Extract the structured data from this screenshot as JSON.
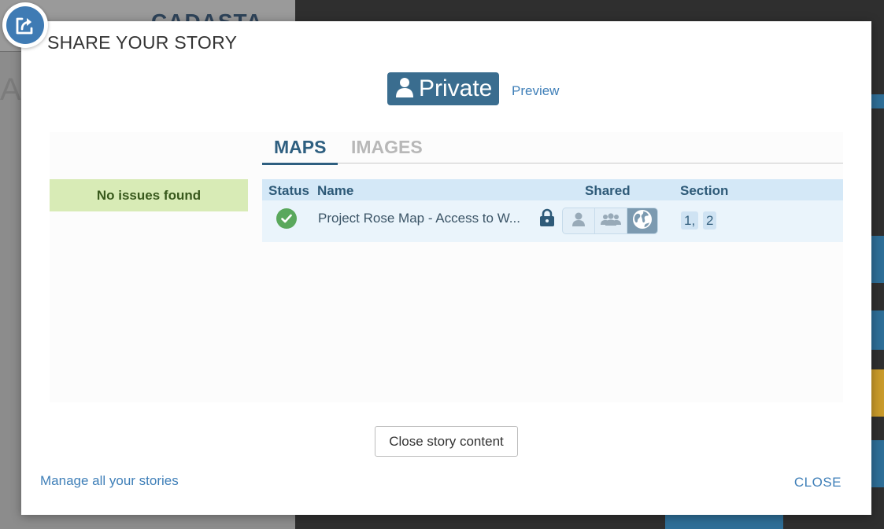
{
  "backdrop": {
    "logo_text": "CADASTA",
    "fragment_text": "A"
  },
  "modal": {
    "title": "SHARE YOUR STORY",
    "privacy": {
      "label": "Private",
      "icon": "person-icon"
    },
    "preview_label": "Preview",
    "issues_label": "No issues found",
    "tabs": [
      {
        "label": "MAPS",
        "active": true
      },
      {
        "label": "IMAGES",
        "active": false
      }
    ],
    "table": {
      "columns": [
        "Status",
        "Name",
        "Shared",
        "Section"
      ],
      "rows": [
        {
          "status": "ok",
          "name": "Project Rose Map - Access to W...",
          "shared_options": [
            "private-icon",
            "organization-icon",
            "public-icon"
          ],
          "shared_selected": "public-icon",
          "sections": [
            "1,",
            "2"
          ]
        }
      ]
    },
    "close_content_label": "Close story content",
    "manage_label": "Manage all your stories",
    "close_label": "CLOSE"
  },
  "colors": {
    "accent": "#3a6d8f",
    "link": "#3f7fb8",
    "success": "#5aa85c",
    "issues_bg": "#d8ebb6",
    "table_header_bg": "#d4e8f7"
  }
}
